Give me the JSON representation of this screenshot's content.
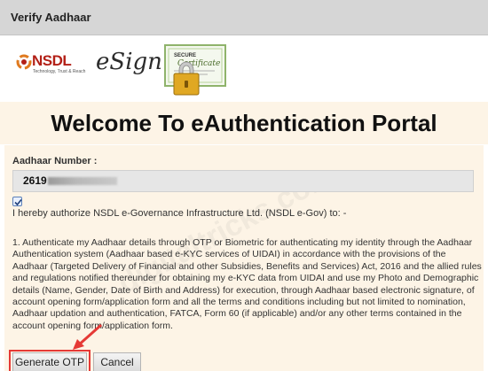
{
  "window": {
    "title": "Verify Aadhaar"
  },
  "logos": {
    "nsdl_text": "NSDL",
    "nsdl_tagline": "Technology, Trust & Reach",
    "esign_text": "eSign",
    "certificate_top": "SECURE",
    "certificate_text": "Certificate"
  },
  "welcome": {
    "heading": "Welcome To eAuthentication Portal"
  },
  "form": {
    "aadhaar_label": "Aadhaar Number :",
    "aadhaar_value": "2619",
    "consent_checked": true,
    "consent_text": "I hereby authorize NSDL e-Governance Infrastructure Ltd. (NSDL e-Gov) to: -",
    "terms_lines": [
      "1. Authenticate my Aadhaar details through OTP or Biometric for authenticating my identity through the Aadhaar",
      "Authentication system (Aadhaar based e-KYC services of UIDAI) in accordance with the provisions of the",
      "Aadhaar (Targeted Delivery of Financial and other Subsidies, Benefits and Services) Act, 2016 and the allied rules",
      "and regulations notified thereunder for obtaining my e-KYC data from UIDAI and use my Photo and Demographic",
      "details (Name, Gender, Date of Birth and Address) for execution, through Aadhaar based electronic signature, of",
      "account opening form/application form and all the terms and conditions including but not limited to nomination,",
      "Aadhaar updation and authentication, FATCA, Form 60 (if applicable) and/or any other terms contained in the",
      "account opening form/application form."
    ]
  },
  "buttons": {
    "generate_otp": "Generate OTP",
    "cancel": "Cancel"
  },
  "watermark": {
    "text": "digitaltricks.com"
  },
  "colors": {
    "highlight": "#e53935",
    "brand_red": "#b32017"
  }
}
